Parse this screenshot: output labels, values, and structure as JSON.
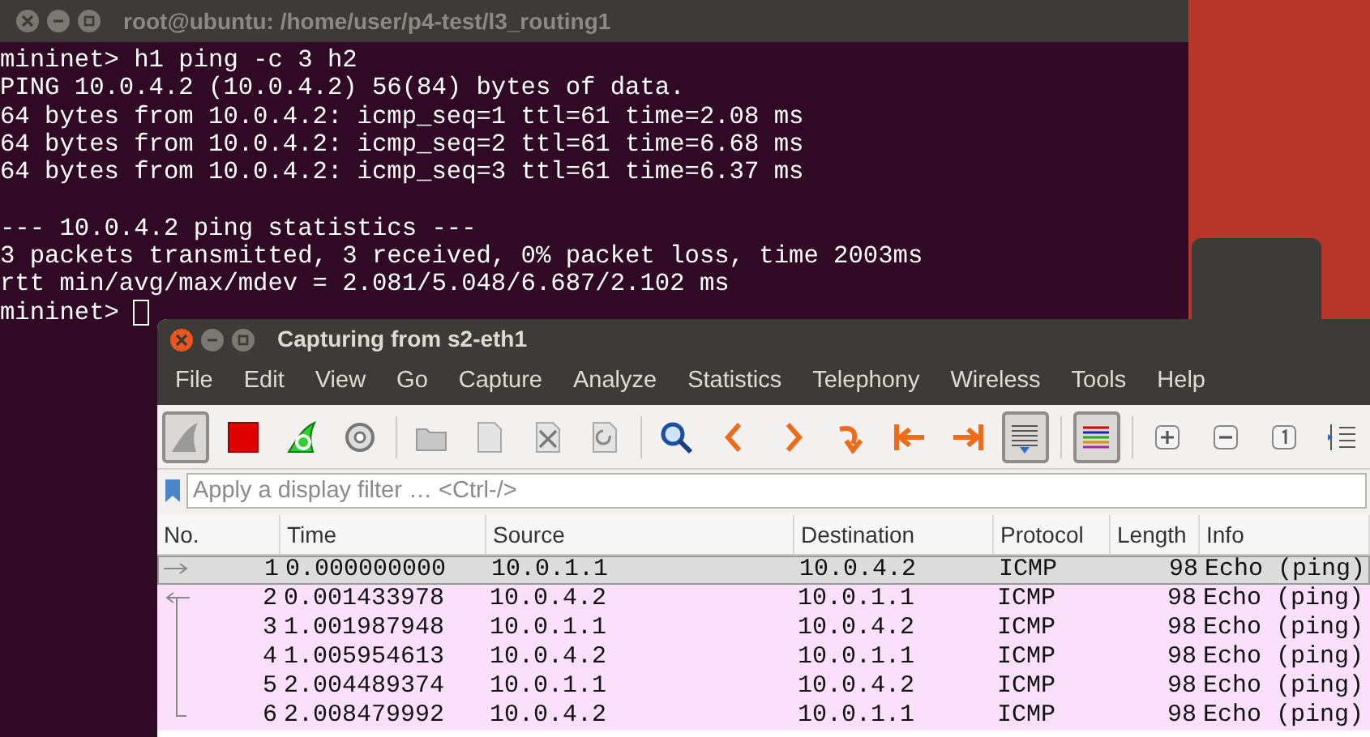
{
  "terminal": {
    "title": "root@ubuntu: /home/user/p4-test/l3_routing1",
    "blocks": [
      [
        "mininet> h1 ping -c 3 h2",
        "PING 10.0.4.2 (10.0.4.2) 56(84) bytes of data.",
        "64 bytes from 10.0.4.2: icmp_seq=1 ttl=61 time=2.08 ms",
        "64 bytes from 10.0.4.2: icmp_seq=2 ttl=61 time=6.68 ms",
        "64 bytes from 10.0.4.2: icmp_seq=3 ttl=61 time=6.37 ms"
      ],
      [
        "--- 10.0.4.2 ping statistics ---",
        "3 packets transmitted, 3 received, 0% packet loss, time 2003ms",
        "rtt min/avg/max/mdev = 2.081/5.048/6.687/2.102 ms",
        "mininet>"
      ]
    ],
    "cursor": true
  },
  "wireshark": {
    "title": "Capturing from s2-eth1",
    "menu": [
      "File",
      "Edit",
      "View",
      "Go",
      "Capture",
      "Analyze",
      "Statistics",
      "Telephony",
      "Wireless",
      "Tools",
      "Help"
    ],
    "toolbar": [
      {
        "kind": "fin",
        "pressed": true
      },
      {
        "kind": "stop",
        "pressed": false
      },
      {
        "kind": "restart",
        "pressed": false
      },
      {
        "kind": "options",
        "pressed": false
      },
      {
        "kind": "separator"
      },
      {
        "kind": "open",
        "pressed": false
      },
      {
        "kind": "save",
        "pressed": false
      },
      {
        "kind": "close",
        "pressed": false
      },
      {
        "kind": "reload",
        "pressed": false
      },
      {
        "kind": "separator"
      },
      {
        "kind": "find",
        "pressed": false
      },
      {
        "kind": "back",
        "pressed": false
      },
      {
        "kind": "forward",
        "pressed": false
      },
      {
        "kind": "goto",
        "pressed": false
      },
      {
        "kind": "first",
        "pressed": false
      },
      {
        "kind": "last",
        "pressed": false
      },
      {
        "kind": "autoscroll",
        "pressed": true
      },
      {
        "kind": "separator"
      },
      {
        "kind": "colorize",
        "pressed": true
      },
      {
        "kind": "separator"
      },
      {
        "kind": "zoomin",
        "pressed": false
      },
      {
        "kind": "zoomout",
        "pressed": false
      },
      {
        "kind": "normal",
        "pressed": false
      },
      {
        "kind": "resize",
        "pressed": false
      }
    ],
    "filter": {
      "placeholder": "Apply a display filter … <Ctrl-/>"
    },
    "columns": [
      "No.",
      "Time",
      "Source",
      "Destination",
      "Protocol",
      "Length",
      "Info"
    ],
    "rows": [
      {
        "cells": [
          "1",
          "0.000000000",
          "10.0.1.1",
          "10.0.4.2",
          "ICMP",
          "98",
          "Echo (ping)"
        ],
        "selected": true
      },
      {
        "cells": [
          "2",
          "0.001433978",
          "10.0.4.2",
          "10.0.1.1",
          "ICMP",
          "98",
          "Echo (ping)"
        ],
        "selected": false
      },
      {
        "cells": [
          "3",
          "1.001987948",
          "10.0.1.1",
          "10.0.4.2",
          "ICMP",
          "98",
          "Echo (ping)"
        ],
        "selected": false
      },
      {
        "cells": [
          "4",
          "1.005954613",
          "10.0.4.2",
          "10.0.1.1",
          "ICMP",
          "98",
          "Echo (ping)"
        ],
        "selected": false
      },
      {
        "cells": [
          "5",
          "2.004489374",
          "10.0.1.1",
          "10.0.4.2",
          "ICMP",
          "98",
          "Echo (ping)"
        ],
        "selected": false
      },
      {
        "cells": [
          "6",
          "2.008479992",
          "10.0.4.2",
          "10.0.1.1",
          "ICMP",
          "98",
          "Echo (ping)"
        ],
        "selected": false
      }
    ]
  }
}
